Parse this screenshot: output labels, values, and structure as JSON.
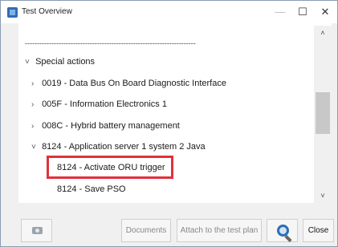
{
  "window": {
    "title": "Test Overview",
    "controls": {
      "minimize": "—",
      "maximize": "☐",
      "close": "✕"
    }
  },
  "tree": {
    "separator": "-----------------------------------------------------------------------",
    "special_actions": "Special actions",
    "items": [
      "0019 - Data Bus On Board Diagnostic Interface",
      "005F - Information Electronics 1",
      "008C - Hybrid battery management",
      "8124 - Application server 1 system 2 Java"
    ],
    "children": [
      "8124 - Activate ORU trigger",
      "8124 - Save PSO"
    ],
    "chevron_expanded": "˅",
    "chevron_collapsed": "›"
  },
  "scrollbar": {
    "up": "˄",
    "down": "˅"
  },
  "buttons": {
    "documents": "Documents",
    "attach": "Attach to the test plan",
    "close": "Close"
  },
  "icons": {
    "camera": "camera-icon",
    "search": "search-icon",
    "app": "app-icon"
  },
  "colors": {
    "highlight": "#e0313b",
    "accent": "#2f6db5"
  }
}
